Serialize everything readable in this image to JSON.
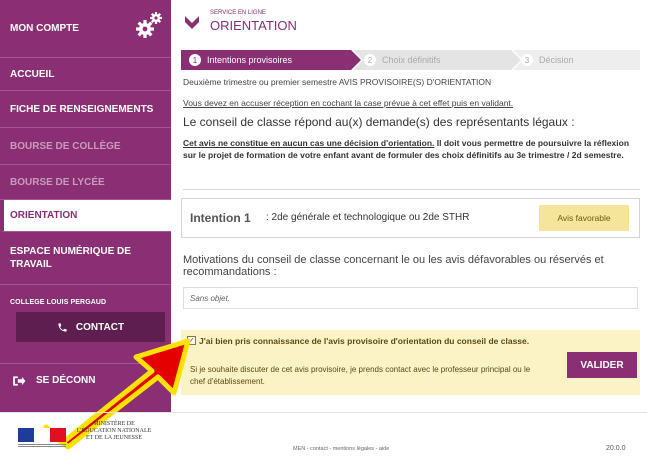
{
  "sidebar": {
    "items": [
      {
        "label": "MON COMPTE"
      },
      {
        "label": "ACCUEIL"
      },
      {
        "label": "FICHE DE RENSEIGNEMENTS"
      },
      {
        "label": "BOURSE DE COLLÈGE"
      },
      {
        "label": "BOURSE DE LYCÉE"
      },
      {
        "label": "ORIENTATION"
      },
      {
        "label": "ESPACE NUMÉRIQUE DE TRAVAIL"
      }
    ],
    "college_label": "COLLEGE LOUIS PERGAUD",
    "contact_label": "CONTACT",
    "logout_label": "SE DÉCONN",
    "gear_icon": "gear-icon",
    "brand_color": "#8a2f73"
  },
  "header": {
    "small": "SERVICE EN LIGNE",
    "title": "ORIENTATION"
  },
  "steps": [
    {
      "num": "1",
      "label": "Intentions provisoires"
    },
    {
      "num": "2",
      "label": "Choix définitifs"
    },
    {
      "num": "3",
      "label": "Décision"
    }
  ],
  "content": {
    "line1": "Deuxième trimestre ou premier semestre   AVIS PROVISOIRE(S) D'ORIENTATION",
    "line2": "Vous devez en accuser réception en cochant la case prévue à cet effet puis en validant.",
    "heading": "Le conseil de classe répond au(x) demande(s) des représentants légaux :",
    "warning_underlined": "Cet avis ne constitue en aucun cas une décision d'orientation.",
    "warning_rest": " Il doit vous permettre de poursuivre la réflexion sur le projet de formation de votre enfant avant de formuler des choix définitifs au 3e trimestre / 2d semestre.",
    "intention_label": "Intention",
    "intention_num": "1",
    "intention_text": ": 2de générale et technologique ou 2de STHR",
    "avis": "Avis favorable",
    "motivations": "Motivations du conseil de classe concernant le ou les avis défavorables ou réservés et recommandations :",
    "sans_objet": "Sans objet.",
    "confirm": "J'ai bien pris connaissance de l'avis provisoire d'orientation du conseil de classe.",
    "confirm_sub": "Si je souhaite discuter de cet avis provisoire, je prends contact avec le professeur principal ou le chef d'établissement.",
    "confirm_checked": true,
    "valider": "VALIDER"
  },
  "footer": {
    "ministere": "MINISTÈRE DE L'ÉDUCATION NATIONALE ET DE LA JEUNESSE",
    "links": "MEN - contact - mentions légales - aide",
    "version": "20.0.0"
  }
}
